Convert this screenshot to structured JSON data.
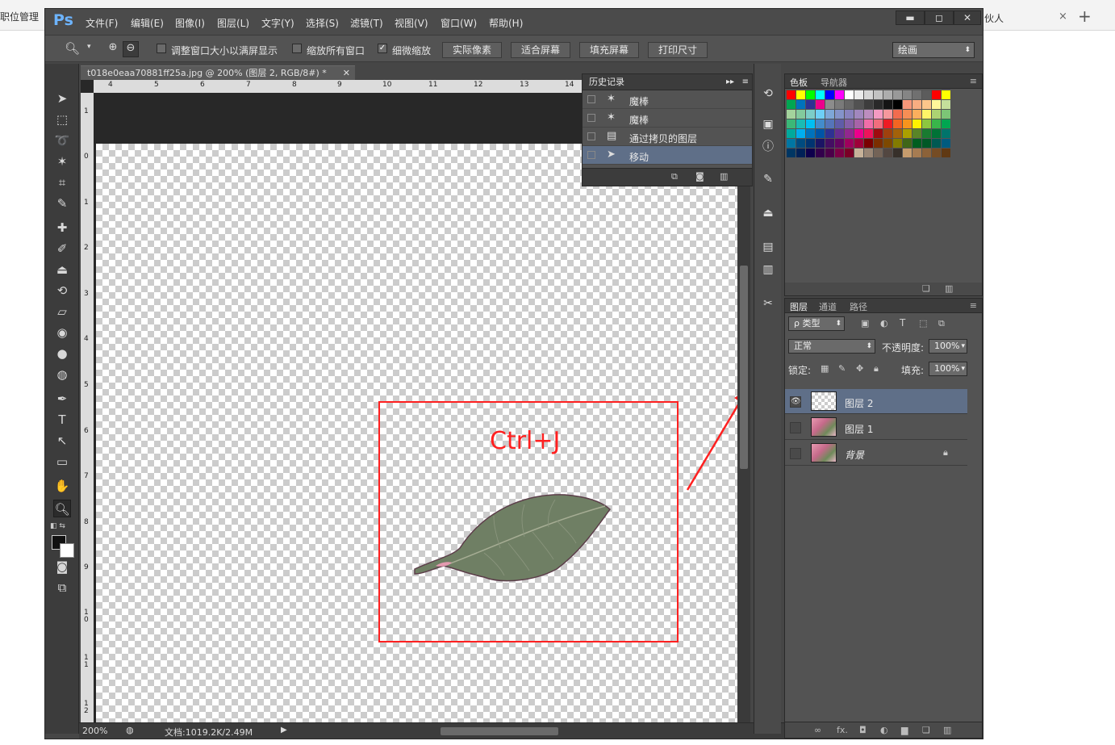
{
  "browser": {
    "tab_left": "职位管理",
    "tab_right": "伙人",
    "close_glyph": "×",
    "new_tab_glyph": "+"
  },
  "app": {
    "logo": "Ps",
    "menu": [
      "文件(F)",
      "编辑(E)",
      "图像(I)",
      "图层(L)",
      "文字(Y)",
      "选择(S)",
      "滤镜(T)",
      "视图(V)",
      "窗口(W)",
      "帮助(H)"
    ],
    "window_buttons": [
      "▬",
      "◻",
      "✕"
    ]
  },
  "options": {
    "resize_windows": "调整窗口大小以满屏显示",
    "zoom_all": "缩放所有窗口",
    "scrubby_zoom": "细微缩放",
    "actual_pixels": "实际像素",
    "fit_screen": "适合屏幕",
    "fill_screen": "填充屏幕",
    "print_size": "打印尺寸",
    "workspace": "绘画"
  },
  "document": {
    "tab_title": "t018e0eaa70881ff25a.jpg @ 200% (图层 2, RGB/8#) *",
    "ruler_h": [
      "4",
      "5",
      "6",
      "7",
      "8",
      "9",
      "10",
      "11",
      "12",
      "13",
      "14"
    ],
    "ruler_v": [
      "1",
      "0",
      "1",
      "2",
      "3",
      "4",
      "5",
      "6",
      "7",
      "8",
      "9",
      "1\n0",
      "1\n1",
      "1\n2"
    ],
    "annotation": "Ctrl+J",
    "zoom_status": "200%",
    "doc_status": "文档:1019.2K/2.49M"
  },
  "history": {
    "title": "历史记录",
    "items": [
      {
        "label": "魔棒",
        "icon": "magic-wand-icon"
      },
      {
        "label": "魔棒",
        "icon": "magic-wand-icon"
      },
      {
        "label": "通过拷贝的图层",
        "icon": "layer-icon"
      },
      {
        "label": "移动",
        "icon": "move-icon"
      }
    ]
  },
  "swatches": {
    "tab_active": "色板",
    "tab_other": "导航器",
    "colors": [
      "#ff0000",
      "#ffff00",
      "#00ff00",
      "#00ffff",
      "#0000ff",
      "#ff00ff",
      "#ffffff",
      "#ebebeb",
      "#d6d6d6",
      "#c2c2c2",
      "#adadad",
      "#999999",
      "#858585",
      "#707070",
      "#5c5c5c",
      "#ff0000",
      "#ffff00",
      "#00a651",
      "#0072bc",
      "#2e3192",
      "#ec008c",
      "#8c8c8c",
      "#7a7a7a",
      "#666666",
      "#525252",
      "#3d3d3d",
      "#292929",
      "#141414",
      "#000000",
      "#f7977a",
      "#f9ad81",
      "#fdc68a",
      "#fff79a",
      "#c4df9b",
      "#a3d39c",
      "#82ca9d",
      "#7bcdc8",
      "#6ecff6",
      "#7ea7d8",
      "#8493ca",
      "#8882be",
      "#a187be",
      "#bc8dbf",
      "#f49ac2",
      "#f6989d",
      "#f26c4f",
      "#f68e55",
      "#fbaf5d",
      "#fff467",
      "#acd372",
      "#7cc576",
      "#3bb878",
      "#1abbb4",
      "#00bff3",
      "#438ccb",
      "#5574b9",
      "#605ca8",
      "#855fa8",
      "#a763a8",
      "#f06ea9",
      "#f26d7d",
      "#ed1c24",
      "#f26522",
      "#f7941d",
      "#fff200",
      "#8dc73f",
      "#39b54a",
      "#00a651",
      "#00a99d",
      "#00aeef",
      "#0072bc",
      "#0054a6",
      "#2e3192",
      "#662d91",
      "#92278f",
      "#ec008c",
      "#ed145b",
      "#9e0b0f",
      "#a0410d",
      "#a3620a",
      "#aba000",
      "#598527",
      "#197b30",
      "#007236",
      "#00746b",
      "#0076a3",
      "#004b80",
      "#003471",
      "#1b1464",
      "#440e62",
      "#630460",
      "#9e005d",
      "#9e0039",
      "#790000",
      "#7b2e00",
      "#7d4900",
      "#827b00",
      "#406618",
      "#005e20",
      "#005826",
      "#005952",
      "#005b7f",
      "#003663",
      "#002157",
      "#0d004c",
      "#32004b",
      "#4b0049",
      "#7b0046",
      "#7a0026",
      "#c7b299",
      "#998675",
      "#736357",
      "#534741",
      "#37302a",
      "#c69c6d",
      "#a67c52",
      "#8c6239",
      "#754c24",
      "#603913"
    ]
  },
  "layers": {
    "tabs": [
      "图层",
      "通道",
      "路径"
    ],
    "filter": "ρ 类型",
    "blend_mode": "正常",
    "opacity_label": "不透明度:",
    "opacity_value": "100%",
    "lock_label": "锁定:",
    "fill_label": "填充:",
    "fill_value": "100%",
    "items": [
      {
        "name": "图层 2",
        "thumb": "transparent",
        "visible": true,
        "selected": true
      },
      {
        "name": "图层 1",
        "thumb": "flower",
        "visible": false,
        "selected": false
      },
      {
        "name": "背景",
        "thumb": "flower",
        "visible": false,
        "selected": false,
        "locked": true
      }
    ],
    "footer_icons": [
      "link-icon",
      "fx-icon",
      "mask-icon",
      "adjustment-icon",
      "folder-icon",
      "new-layer-icon",
      "trash-icon"
    ],
    "footer_labels": [
      "∞",
      "fx.",
      "◘",
      "◐",
      "▆",
      "❏",
      "🗑"
    ]
  },
  "colors": {
    "annotation_red": "#ff2020",
    "selected_row": "#5f6f88",
    "ps_blue": "#6db4ff"
  }
}
